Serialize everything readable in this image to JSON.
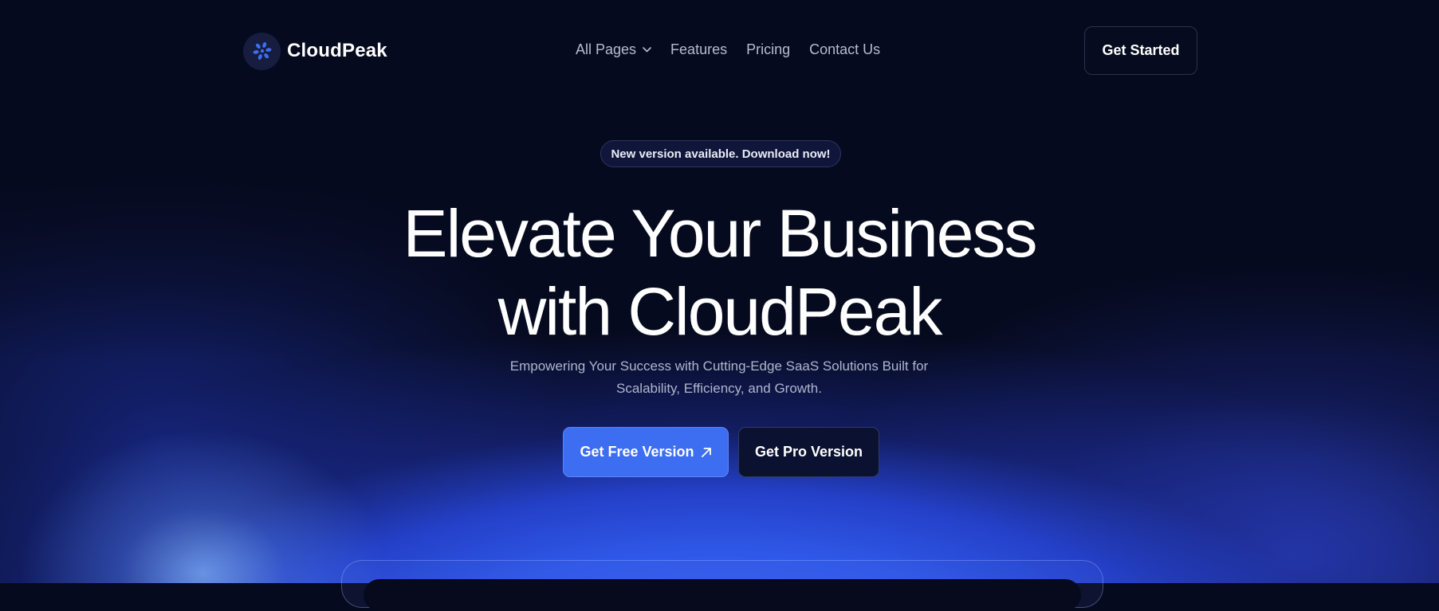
{
  "brand": {
    "name": "CloudPeak",
    "logo_icon": "pinwheel-logo-icon",
    "accent": "#3d6df0"
  },
  "nav": {
    "items": [
      {
        "label": "All Pages",
        "icon": "chevron-down-icon"
      },
      {
        "label": "Features"
      },
      {
        "label": "Pricing"
      },
      {
        "label": "Contact Us"
      }
    ],
    "cta_label": "Get Started"
  },
  "hero": {
    "badge": "New version available. Download now!",
    "title_line1": "Elevate Your Business",
    "title_line2": "with CloudPeak",
    "subtitle_line1": "Empowering Your Success with Cutting-Edge SaaS Solutions Built for",
    "subtitle_line2": "Scalability, Efficiency, and Growth.",
    "primary_cta": {
      "label": "Get Free Version",
      "icon": "arrow-up-right-icon"
    },
    "secondary_cta": {
      "label": "Get Pro Version"
    }
  },
  "colors": {
    "background": "#060a1e",
    "glow": "#3b6cf6",
    "text_muted": "#aeb6cc"
  }
}
